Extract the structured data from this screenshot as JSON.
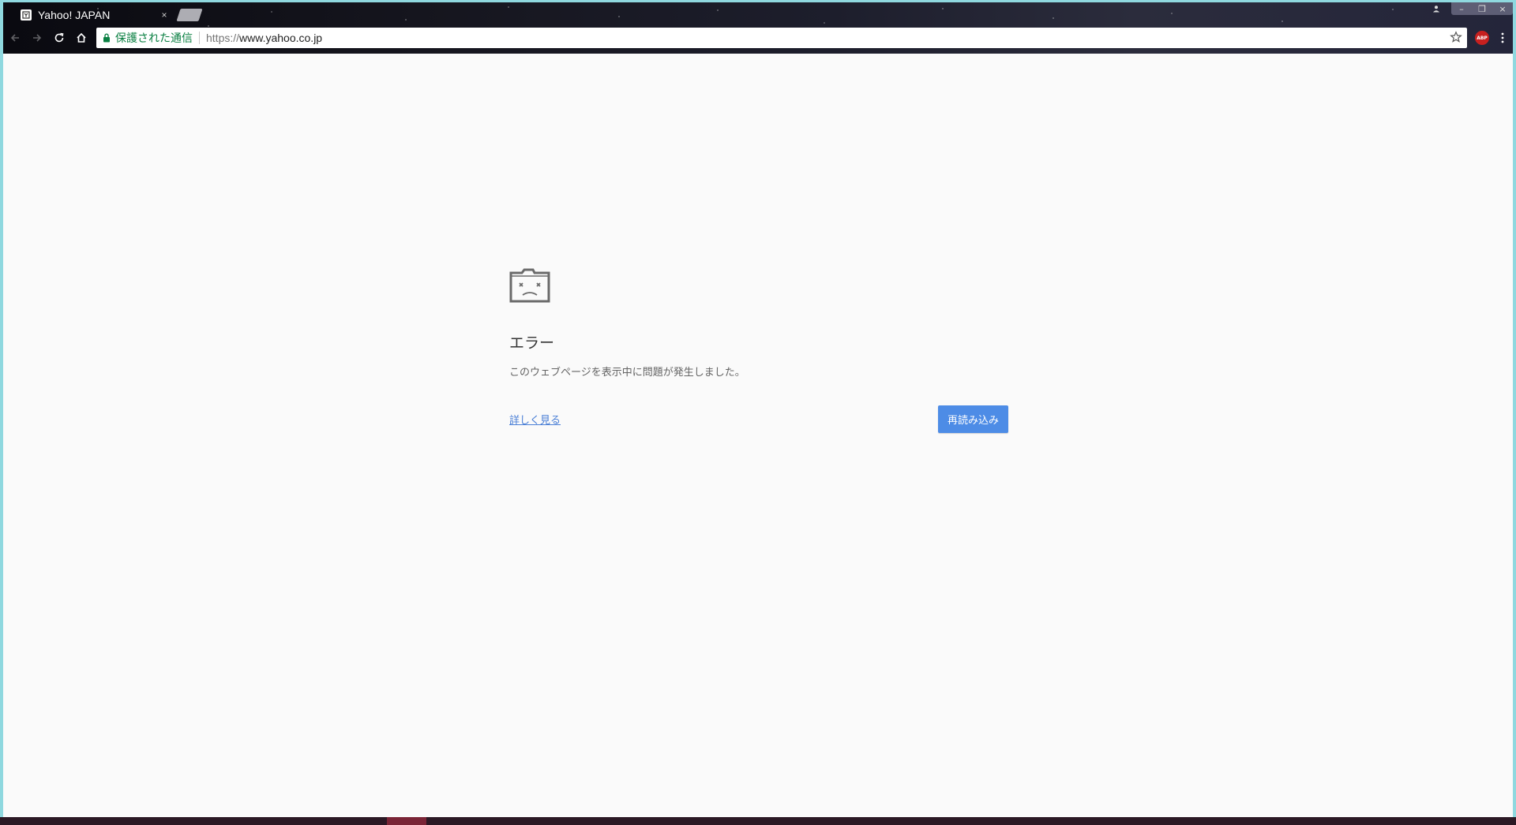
{
  "browser": {
    "tab": {
      "title": "Yahoo! JAPAN",
      "close_glyph": "×"
    },
    "window_controls": {
      "user": "user-icon",
      "minimize": "–",
      "restore": "❐",
      "close": "×"
    },
    "toolbar": {
      "back": "back-icon",
      "forward": "forward-icon",
      "reload": "reload-icon",
      "home": "home-icon"
    },
    "omnibox": {
      "secure_label": "保護された通信",
      "url_scheme": "https://",
      "url_host": "www.yahoo.co.jp"
    },
    "extensions": {
      "abp_label": "ABP"
    }
  },
  "error_page": {
    "heading": "エラー",
    "description": "このウェブページを表示中に問題が発生しました。",
    "details_link": "詳しく見る",
    "reload_button": "再読み込み"
  },
  "colors": {
    "secure": "#0b8043",
    "reload_button": "#4d8ce6",
    "link": "#4a7fd6",
    "page_bg": "#fafafa",
    "window_frame": "#8fd8df"
  }
}
